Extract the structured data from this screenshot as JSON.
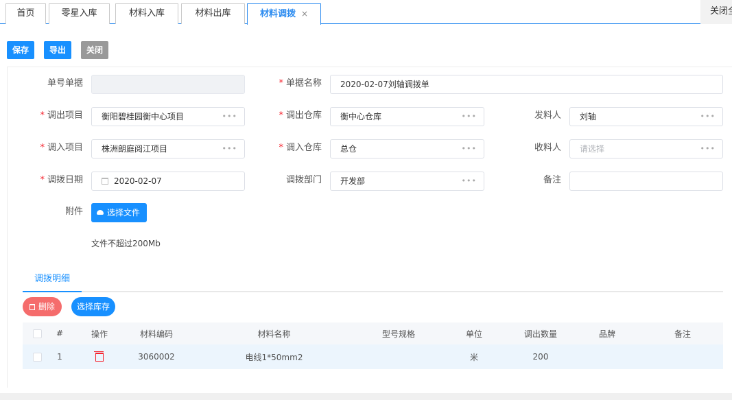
{
  "tabs": [
    {
      "label": "首页"
    },
    {
      "label": "零星入库"
    },
    {
      "label": "材料入库"
    },
    {
      "label": "材料出库"
    },
    {
      "label": "材料调拨",
      "active": true
    }
  ],
  "tab_close_glyph": "×",
  "close_all_label": "关闭全",
  "actions": {
    "save": "保存",
    "export": "导出",
    "close": "关闭"
  },
  "form": {
    "doc_no": {
      "label": "单号单据",
      "value": ""
    },
    "doc_name": {
      "label": "单据名称",
      "value": "2020-02-07刘轴调拨单"
    },
    "out_project": {
      "label": "调出项目",
      "value": "衡阳碧桂园衡中心项目"
    },
    "out_warehouse": {
      "label": "调出仓库",
      "value": "衡中心仓库"
    },
    "sender": {
      "label": "发料人",
      "value": "刘轴"
    },
    "in_project": {
      "label": "调入项目",
      "value": "株洲朗庭阅江项目"
    },
    "in_warehouse": {
      "label": "调入仓库",
      "value": "总仓"
    },
    "receiver": {
      "label": "收料人",
      "placeholder": "请选择"
    },
    "date": {
      "label": "调拨日期",
      "value": "2020-02-07"
    },
    "dept": {
      "label": "调拨部门",
      "value": "开发部"
    },
    "remark": {
      "label": "备注",
      "value": ""
    },
    "attachment": {
      "label": "附件",
      "button": "选择文件",
      "hint": "文件不超过200Mb"
    }
  },
  "detail_tab": "调拨明细",
  "detail_actions": {
    "delete": "删除",
    "select_stock": "选择库存"
  },
  "table": {
    "columns": [
      "#",
      "操作",
      "材料编码",
      "材料名称",
      "型号规格",
      "单位",
      "调出数量",
      "品牌",
      "备注"
    ],
    "rows": [
      {
        "index": "1",
        "code": "3060002",
        "name": "电线1*50mm2",
        "spec": "",
        "unit": "米",
        "qty": "200",
        "brand": "",
        "remark": ""
      }
    ]
  },
  "colors": {
    "primary": "#1890ff",
    "danger": "#f56c6c",
    "required": "#f5222d",
    "gray_button": "#999999"
  },
  "icons": [
    "close-icon",
    "ellipsis-icon",
    "calendar-icon",
    "cloud-upload-icon",
    "trash-icon",
    "checkbox-icon"
  ]
}
